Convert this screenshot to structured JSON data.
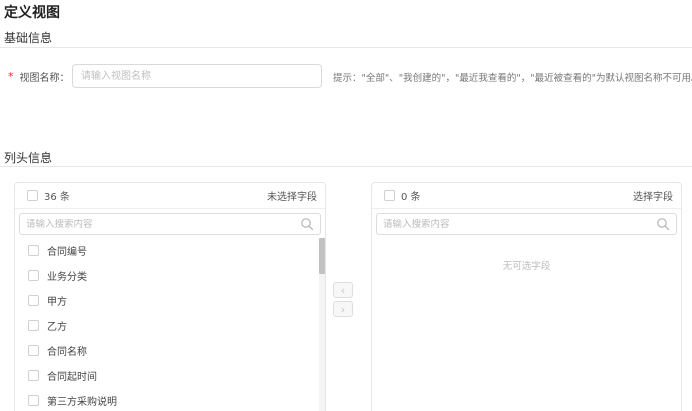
{
  "page": {
    "title": "定义视图"
  },
  "basic_info": {
    "section_title": "基础信息",
    "view_name": {
      "label": "视图名称：",
      "required_mark": "*",
      "value": "",
      "placeholder": "请输入视图名称"
    },
    "hint": "提示：\"全部\"、\"我创建的\"，\"最近我查看的\"，\"最近被查看的\"为默认视图名称不可用。"
  },
  "column_info": {
    "section_title": "列头信息",
    "source_panel": {
      "count_label": "36 条",
      "title": "未选择字段",
      "search_placeholder": "请输入搜索内容",
      "items": [
        {
          "label": "合同编号"
        },
        {
          "label": "业务分类"
        },
        {
          "label": "甲方"
        },
        {
          "label": "乙方"
        },
        {
          "label": "合同名称"
        },
        {
          "label": "合同起时间"
        },
        {
          "label": "第三方采购说明"
        }
      ]
    },
    "transfer_buttons": {
      "to_left_icon": "chevron-left-icon",
      "to_right_icon": "chevron-right-icon",
      "left_glyph": "‹",
      "right_glyph": "›"
    },
    "target_panel": {
      "count_label": "0 条",
      "title": "选择字段",
      "search_placeholder": "请输入搜索内容",
      "empty_text": "无可选字段"
    }
  }
}
